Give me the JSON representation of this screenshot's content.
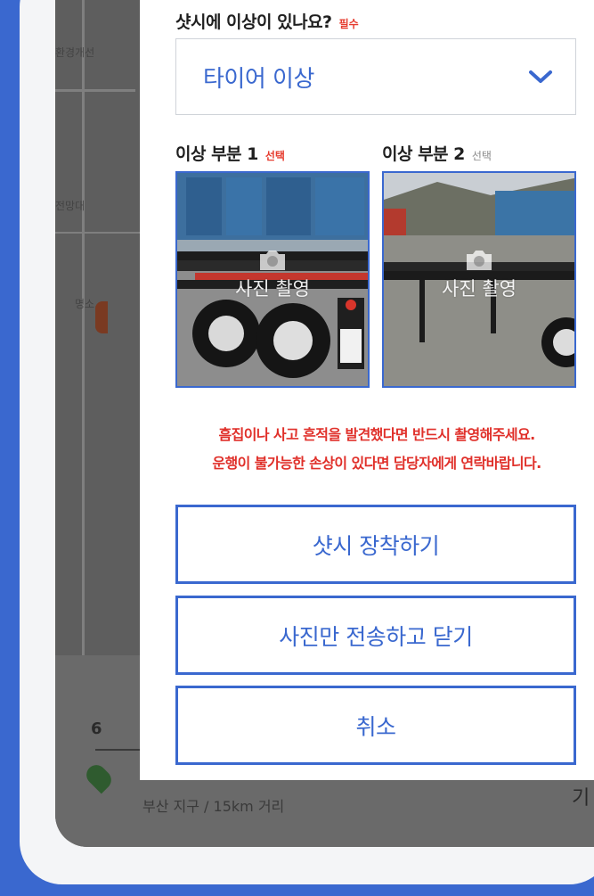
{
  "background_map": {
    "labels": [
      "환경개선",
      "전망대",
      "명소"
    ],
    "bottom_text": "6",
    "bottom_sub": "부산 지구 / 15km 거리",
    "bottom_right_text": "기"
  },
  "modal": {
    "question_label": "샷시에 이상이 있나요?",
    "required_tag": "필수",
    "select": {
      "selected_value": "타이어 이상"
    },
    "photo_parts": [
      {
        "label": "이상 부분 1",
        "tag": "선택",
        "tag_color": "#e63b2e",
        "camera_text": "사진 촬영"
      },
      {
        "label": "이상 부분 2",
        "tag": "선택",
        "tag_color": "#8a8a8a",
        "camera_text": "사진 촬영"
      }
    ],
    "warning_lines": [
      "흠집이나 사고 흔적을 발견했다면 반드시 촬영해주세요.",
      "운행이 불가능한 손상이 있다면 담당자에게 연락바랍니다."
    ],
    "buttons": {
      "attach": "샷시 장착하기",
      "send_photos": "사진만 전송하고 닫기",
      "cancel": "취소"
    }
  },
  "colors": {
    "accent": "#3a68cf",
    "warning": "#e0302a",
    "required": "#e63b2e"
  },
  "icons": [
    "chevron-down-icon",
    "camera-icon"
  ]
}
